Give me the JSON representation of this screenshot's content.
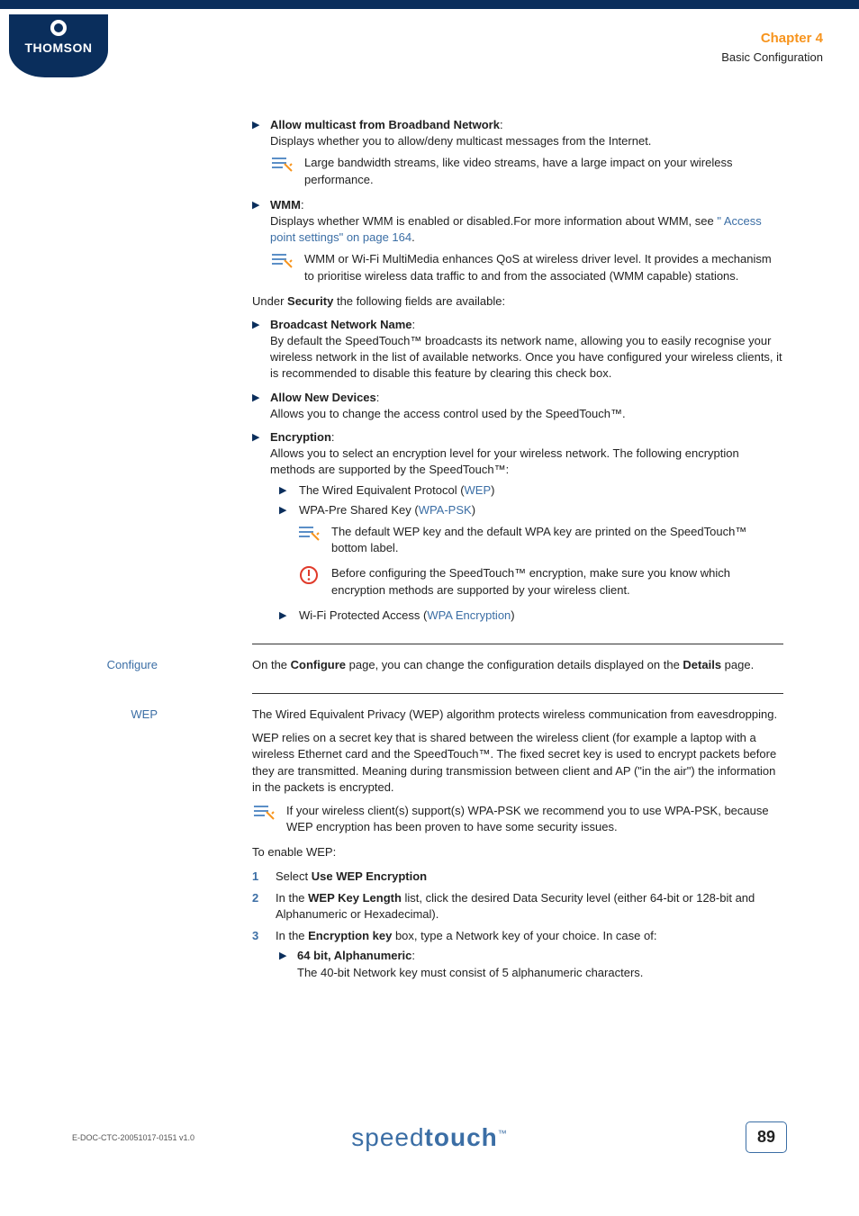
{
  "header": {
    "logo_text": "THOMSON",
    "chapter": "Chapter 4",
    "subtitle": "Basic Configuration"
  },
  "bullets": {
    "multicast": {
      "title": "Allow multicast from Broadband Network",
      "desc": "Displays whether you to allow/deny multicast messages from the Internet.",
      "note": "Large bandwidth streams, like video streams, have a large impact on your wireless performance."
    },
    "wmm": {
      "title": "WMM",
      "desc_a": "Displays whether WMM is enabled or disabled.For more information about WMM, see ",
      "link": "\" Access point settings\" on page 164",
      "desc_b": ".",
      "note": "WMM or Wi-Fi MultiMedia enhances QoS at wireless driver level. It provides a mechanism to prioritise wireless data traffic to and from the associated (WMM capable) stations."
    },
    "security_intro_a": "Under ",
    "security_intro_b": "Security",
    "security_intro_c": " the following fields are available:",
    "broadcast": {
      "title": "Broadcast Network Name",
      "desc": "By default the SpeedTouch™ broadcasts its network name, allowing you to easily recognise your wireless network in the list of available networks. Once you have configured your wireless clients, it is recommended to disable this feature by clearing this check box."
    },
    "allownew": {
      "title": "Allow New Devices",
      "desc": "Allows you to change the access control used by the SpeedTouch™."
    },
    "encryption": {
      "title": "Encryption",
      "desc": "Allows you to select an encryption level for your wireless network. The following encryption methods are supported by the SpeedTouch™:",
      "item1_a": "The Wired Equivalent Protocol (",
      "item1_link": "WEP",
      "item1_b": ")",
      "item2_a": "WPA-Pre Shared Key (",
      "item2_link": "WPA-PSK",
      "item2_b": ")",
      "note": "The default WEP key and the default WPA key are printed on the SpeedTouch™ bottom label.",
      "warn": "Before configuring the SpeedTouch™ encryption, make sure you know which encryption methods are supported by your wireless client.",
      "item3_a": "Wi-Fi Protected Access (",
      "item3_link": "WPA Encryption",
      "item3_b": ")"
    }
  },
  "configure": {
    "aside": "Configure",
    "text_a": "On the ",
    "text_b": "Configure",
    "text_c": " page, you can change the configuration details displayed on the ",
    "text_d": "Details",
    "text_e": " page."
  },
  "wep": {
    "aside": "WEP",
    "p1": "The Wired Equivalent Privacy (WEP) algorithm protects wireless communication from eavesdropping.",
    "p2": "WEP relies on a secret key that is shared between the wireless client (for example a laptop with a wireless Ethernet card and the SpeedTouch™. The fixed secret key is used to encrypt packets before they are transmitted. Meaning during transmission between client and AP (\"in the air\") the information in the packets is encrypted.",
    "note": "If your wireless client(s) support(s) WPA-PSK we recommend you to use WPA-PSK, because WEP encryption has been proven to have some security issues.",
    "enable": "To enable WEP:",
    "step1_a": "Select ",
    "step1_b": "Use WEP Encryption",
    "step2_a": "In the ",
    "step2_b": "WEP Key Length",
    "step2_c": " list, click the desired Data Security level (either 64-bit or 128-bit and Alphanumeric or Hexadecimal).",
    "step3_a": "In the ",
    "step3_b": "Encryption key",
    "step3_c": " box, type a Network key of your choice. In case of:",
    "sub_title": "64 bit, Alphanumeric",
    "sub_desc": "The 40-bit Network key must consist of 5 alphanumeric characters."
  },
  "footer": {
    "doc_id": "E-DOC-CTC-20051017-0151 v1.0",
    "brand_light": "speed",
    "brand_bold": "touch",
    "page": "89"
  }
}
